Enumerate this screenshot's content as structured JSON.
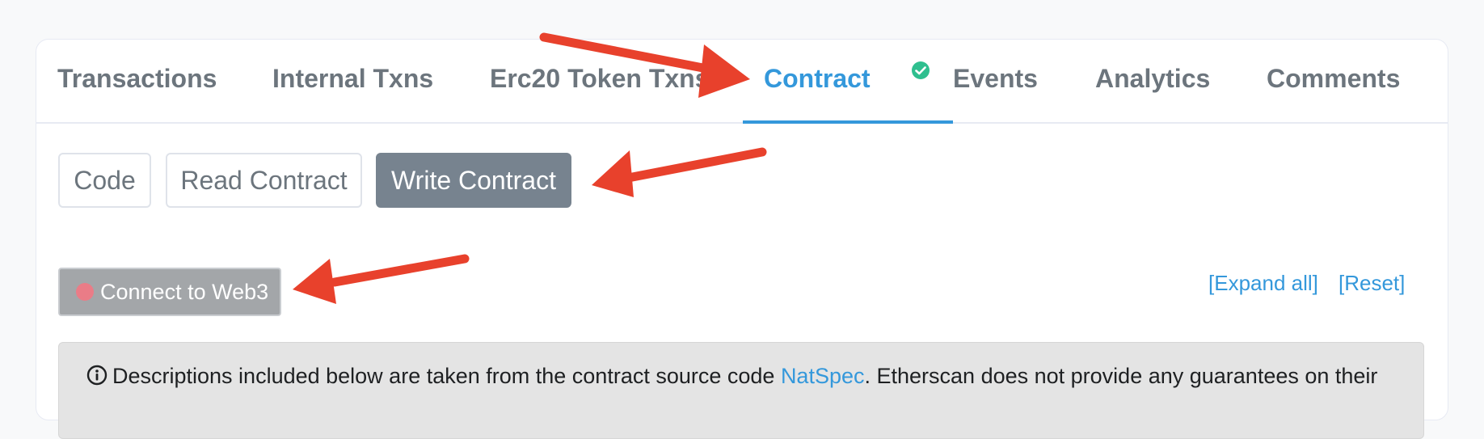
{
  "tabs": [
    {
      "label": "Transactions"
    },
    {
      "label": "Internal Txns"
    },
    {
      "label": "Erc20 Token Txns"
    },
    {
      "label": "Contract"
    },
    {
      "label": "Events"
    },
    {
      "label": "Analytics"
    },
    {
      "label": "Comments"
    }
  ],
  "active_tab": "Contract",
  "subtabs": [
    {
      "label": "Code"
    },
    {
      "label": "Read Contract"
    },
    {
      "label": "Write Contract"
    }
  ],
  "active_subtab": "Write Contract",
  "connect_button": {
    "label": "Connect to Web3"
  },
  "links": {
    "expand_all": "[Expand all]",
    "reset": "[Reset]"
  },
  "notice": {
    "text_before": "Descriptions included below are taken from the contract source code ",
    "link": "NatSpec",
    "text_after": ". Etherscan does not provide any guarantees on their"
  },
  "colors": {
    "accent": "#3498db",
    "verified": "#2fbf8f",
    "active_subtab_bg": "#77838f",
    "annotation_arrow": "#e8412c",
    "status_dot": "#ea7c87"
  }
}
